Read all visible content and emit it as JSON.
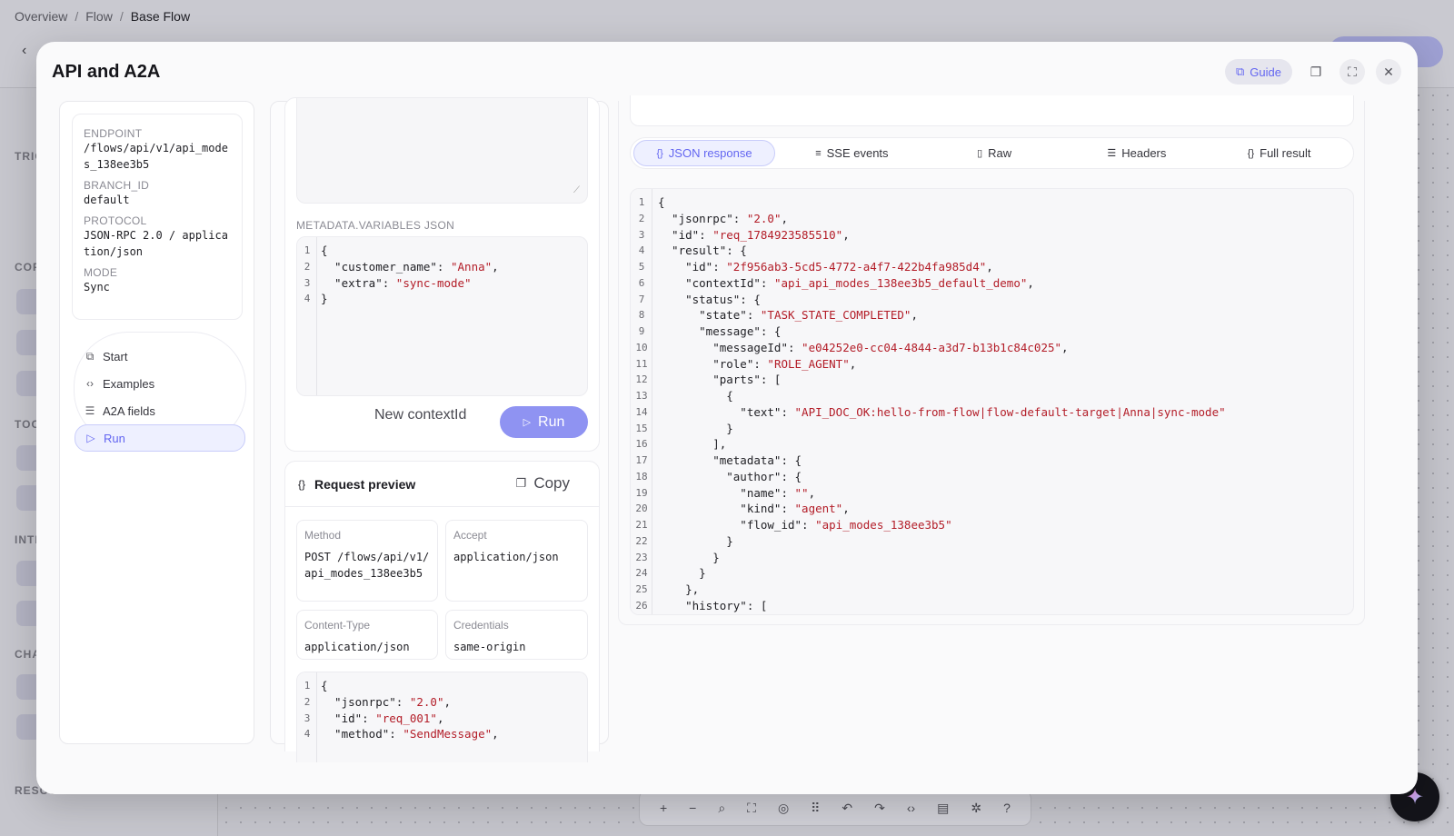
{
  "breadcrumb": [
    "Overview",
    "Flow",
    "Base Flow"
  ],
  "background": {
    "sidebar_sections": [
      "TRIG",
      "COP",
      "TOO",
      "INTE",
      "CHA",
      "RESOURCES ?"
    ]
  },
  "modal": {
    "title": "API and A2A",
    "guide_label": "Guide"
  },
  "info": {
    "endpoint_label": "ENDPOINT",
    "endpoint_value": "/flows/api/v1/api_modes_138ee3b5",
    "branch_label": "BRANCH_ID",
    "branch_value": "default",
    "protocol_label": "PROTOCOL",
    "protocol_value": "JSON-RPC 2.0 / application/json",
    "mode_label": "MODE",
    "mode_value": "Sync"
  },
  "nav": [
    {
      "label": "Start",
      "icon": "book-icon"
    },
    {
      "label": "Examples",
      "icon": "code-icon"
    },
    {
      "label": "A2A fields",
      "icon": "list-icon"
    },
    {
      "label": "Run",
      "icon": "play-icon",
      "active": true
    }
  ],
  "request": {
    "metadata_label": "METADATA.VARIABLES JSON",
    "metadata_lines": [
      {
        "n": "1",
        "segs": [
          {
            "t": "{",
            "c": "k"
          }
        ]
      },
      {
        "n": "2",
        "segs": [
          {
            "t": "  \"customer_name\": ",
            "c": "k"
          },
          {
            "t": "\"Anna\"",
            "c": "s"
          },
          {
            "t": ",",
            "c": "k"
          }
        ]
      },
      {
        "n": "3",
        "segs": [
          {
            "t": "  \"extra\": ",
            "c": "k"
          },
          {
            "t": "\"sync-mode\"",
            "c": "s"
          }
        ]
      },
      {
        "n": "4",
        "segs": [
          {
            "t": "}",
            "c": "k"
          }
        ]
      }
    ],
    "new_context_label": "New contextId",
    "run_label": "Run"
  },
  "preview": {
    "title": "Request preview",
    "copy_label": "Copy",
    "method_label": "Method",
    "method_value": "POST /flows/api/v1/api_modes_138ee3b5",
    "accept_label": "Accept",
    "accept_value": "application/json",
    "content_type_label": "Content-Type",
    "content_type_value": "application/json",
    "credentials_label": "Credentials",
    "credentials_value": "same-origin",
    "body_lines": [
      {
        "n": "1",
        "segs": [
          {
            "t": "{",
            "c": "k"
          }
        ]
      },
      {
        "n": "2",
        "segs": [
          {
            "t": "  \"jsonrpc\": ",
            "c": "k"
          },
          {
            "t": "\"2.0\"",
            "c": "s"
          },
          {
            "t": ",",
            "c": "k"
          }
        ]
      },
      {
        "n": "3",
        "segs": [
          {
            "t": "  \"id\": ",
            "c": "k"
          },
          {
            "t": "\"req_001\"",
            "c": "s"
          },
          {
            "t": ",",
            "c": "k"
          }
        ]
      },
      {
        "n": "4",
        "segs": [
          {
            "t": "  \"method\": ",
            "c": "k"
          },
          {
            "t": "\"SendMessage\"",
            "c": "s"
          },
          {
            "t": ",",
            "c": "k"
          }
        ]
      }
    ]
  },
  "response": {
    "tabs": [
      {
        "label": "JSON response",
        "icon": "{}",
        "active": true
      },
      {
        "label": "SSE events",
        "icon": "≡"
      },
      {
        "label": "Raw",
        "icon": "▯"
      },
      {
        "label": "Headers",
        "icon": "☰"
      },
      {
        "label": "Full result",
        "icon": "{}"
      }
    ],
    "lines": [
      {
        "n": "1",
        "segs": [
          {
            "t": "{",
            "c": "k"
          }
        ]
      },
      {
        "n": "2",
        "segs": [
          {
            "t": "  \"jsonrpc\": ",
            "c": "k"
          },
          {
            "t": "\"2.0\"",
            "c": "s"
          },
          {
            "t": ",",
            "c": "k"
          }
        ]
      },
      {
        "n": "3",
        "segs": [
          {
            "t": "  \"id\": ",
            "c": "k"
          },
          {
            "t": "\"req_1784923585510\"",
            "c": "s"
          },
          {
            "t": ",",
            "c": "k"
          }
        ]
      },
      {
        "n": "4",
        "segs": [
          {
            "t": "  \"result\": {",
            "c": "k"
          }
        ]
      },
      {
        "n": "5",
        "segs": [
          {
            "t": "    \"id\": ",
            "c": "k"
          },
          {
            "t": "\"2f956ab3-5cd5-4772-a4f7-422b4fa985d4\"",
            "c": "s"
          },
          {
            "t": ",",
            "c": "k"
          }
        ]
      },
      {
        "n": "6",
        "segs": [
          {
            "t": "    \"contextId\": ",
            "c": "k"
          },
          {
            "t": "\"api_api_modes_138ee3b5_default_demo\"",
            "c": "s"
          },
          {
            "t": ",",
            "c": "k"
          }
        ]
      },
      {
        "n": "7",
        "segs": [
          {
            "t": "    \"status\": {",
            "c": "k"
          }
        ]
      },
      {
        "n": "8",
        "segs": [
          {
            "t": "      \"state\": ",
            "c": "k"
          },
          {
            "t": "\"TASK_STATE_COMPLETED\"",
            "c": "s"
          },
          {
            "t": ",",
            "c": "k"
          }
        ]
      },
      {
        "n": "9",
        "segs": [
          {
            "t": "      \"message\": {",
            "c": "k"
          }
        ]
      },
      {
        "n": "10",
        "segs": [
          {
            "t": "        \"messageId\": ",
            "c": "k"
          },
          {
            "t": "\"e04252e0-cc04-4844-a3d7-b13b1c84c025\"",
            "c": "s"
          },
          {
            "t": ",",
            "c": "k"
          }
        ]
      },
      {
        "n": "11",
        "segs": [
          {
            "t": "        \"role\": ",
            "c": "k"
          },
          {
            "t": "\"ROLE_AGENT\"",
            "c": "s"
          },
          {
            "t": ",",
            "c": "k"
          }
        ]
      },
      {
        "n": "12",
        "segs": [
          {
            "t": "        \"parts\": [",
            "c": "k"
          }
        ]
      },
      {
        "n": "13",
        "segs": [
          {
            "t": "          {",
            "c": "k"
          }
        ]
      },
      {
        "n": "14",
        "segs": [
          {
            "t": "            \"text\": ",
            "c": "k"
          },
          {
            "t": "\"API_DOC_OK:hello-from-flow|flow-default-target|Anna|sync-mode\"",
            "c": "s"
          }
        ]
      },
      {
        "n": "15",
        "segs": [
          {
            "t": "          }",
            "c": "k"
          }
        ]
      },
      {
        "n": "16",
        "segs": [
          {
            "t": "        ],",
            "c": "k"
          }
        ]
      },
      {
        "n": "17",
        "segs": [
          {
            "t": "        \"metadata\": {",
            "c": "k"
          }
        ]
      },
      {
        "n": "18",
        "segs": [
          {
            "t": "          \"author\": {",
            "c": "k"
          }
        ]
      },
      {
        "n": "19",
        "segs": [
          {
            "t": "            \"name\": ",
            "c": "k"
          },
          {
            "t": "\"\"",
            "c": "s"
          },
          {
            "t": ",",
            "c": "k"
          }
        ]
      },
      {
        "n": "20",
        "segs": [
          {
            "t": "            \"kind\": ",
            "c": "k"
          },
          {
            "t": "\"agent\"",
            "c": "s"
          },
          {
            "t": ",",
            "c": "k"
          }
        ]
      },
      {
        "n": "21",
        "segs": [
          {
            "t": "            \"flow_id\": ",
            "c": "k"
          },
          {
            "t": "\"api_modes_138ee3b5\"",
            "c": "s"
          }
        ]
      },
      {
        "n": "22",
        "segs": [
          {
            "t": "          }",
            "c": "k"
          }
        ]
      },
      {
        "n": "23",
        "segs": [
          {
            "t": "        }",
            "c": "k"
          }
        ]
      },
      {
        "n": "24",
        "segs": [
          {
            "t": "      }",
            "c": "k"
          }
        ]
      },
      {
        "n": "25",
        "segs": [
          {
            "t": "    },",
            "c": "k"
          }
        ]
      },
      {
        "n": "26",
        "segs": [
          {
            "t": "    \"history\": [",
            "c": "k"
          }
        ]
      }
    ]
  },
  "colors": {
    "accent": "#6366f1",
    "run_button": "#8f93f2",
    "string": "#b31d28"
  }
}
